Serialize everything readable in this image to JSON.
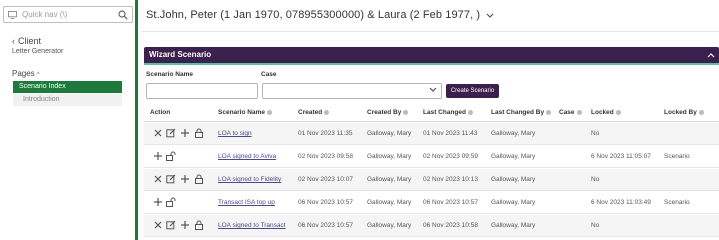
{
  "sidebar": {
    "quick_nav_placeholder": "Quick nav (\\)",
    "client_label": "Client",
    "client_sub": "Letter Generator",
    "pages_label": "Pages",
    "items": [
      {
        "label": "Scenario Index",
        "active": true
      },
      {
        "label": "Introduction",
        "active": false
      }
    ]
  },
  "header": {
    "title": "St.John, Peter (1 Jan 1970, 078955300000) & Laura (2 Feb 1977, )"
  },
  "panel": {
    "title": "Wizard Scenario",
    "filters": {
      "scenario_name_label": "Scenario Name",
      "scenario_name_value": "",
      "case_label": "Case",
      "case_value": "",
      "create_button": "Create Scenario"
    },
    "columns": [
      "Action",
      "Scenario Name",
      "Created",
      "Created By",
      "Last Changed",
      "Last Changed By",
      "Case",
      "Locked",
      "Locked By"
    ],
    "rows": [
      {
        "actions": [
          "delete",
          "edit",
          "add",
          "lock"
        ],
        "scenario_name": "LOA to sign",
        "created": "01 Nov 2023 11:35",
        "created_by": "Galloway, Mary",
        "last_changed": "01 Nov 2023 11:43",
        "last_changed_by": "Galloway, Mary",
        "case": "",
        "locked": "No",
        "locked_by": ""
      },
      {
        "actions": [
          "add",
          "unlock"
        ],
        "scenario_name": "LOA signed to Aviva",
        "created": "02 Nov 2023 09:58",
        "created_by": "Galloway, Mary",
        "last_changed": "02 Nov 2023 09:59",
        "last_changed_by": "Galloway, Mary",
        "case": "",
        "locked": "6 Nov 2023 11:05:07",
        "locked_by": "Scenario"
      },
      {
        "actions": [
          "delete",
          "edit",
          "add",
          "lock"
        ],
        "scenario_name": "LOA signed to Fidelity",
        "created": "02 Nov 2023 10:07",
        "created_by": "Galloway, Mary",
        "last_changed": "02 Nov 2023 10:13",
        "last_changed_by": "Galloway, Mary",
        "case": "",
        "locked": "No",
        "locked_by": ""
      },
      {
        "actions": [
          "add",
          "unlock"
        ],
        "scenario_name": "Transact ISA top up",
        "created": "06 Nov 2023 10:57",
        "created_by": "Galloway, Mary",
        "last_changed": "06 Nov 2023 10:57",
        "last_changed_by": "Galloway, Mary",
        "case": "",
        "locked": "6 Nov 2023 11:03:49",
        "locked_by": "Scenario"
      },
      {
        "actions": [
          "delete",
          "edit",
          "add",
          "lock"
        ],
        "scenario_name": "LOA signed to Transact",
        "created": "06 Nov 2023 10:57",
        "created_by": "Galloway, Mary",
        "last_changed": "06 Nov 2023 10:58",
        "last_changed_by": "Galloway, Mary",
        "case": "",
        "locked": "No",
        "locked_by": ""
      }
    ]
  },
  "icons": {
    "monitor": "monitor-icon",
    "search": "search-icon",
    "back": "chevron-left-icon",
    "title_caret": "chevron-down-icon",
    "collapse": "chevron-up-icon",
    "delete": "close-icon",
    "edit": "edit-icon",
    "add": "plus-icon",
    "lock": "lock-icon",
    "unlock": "unlock-icon"
  },
  "colors": {
    "sidebar_accent": "#1e7a3c",
    "panel_header": "#3b1f4d",
    "panel_accent": "#56c2a4",
    "link": "#4a4a8a"
  }
}
